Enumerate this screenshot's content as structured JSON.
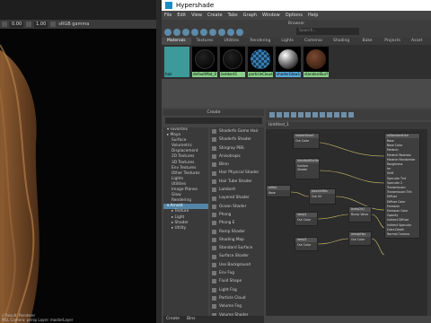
{
  "viewport": {
    "field1": "0.00",
    "field2": "1.00",
    "colorspace": "sRGB gamma",
    "status_line1": "// Result: Renderer",
    "status_line2": "MEL  Camera: persp  Layer: masterLayer"
  },
  "window": {
    "title": "Hypershade"
  },
  "menu": [
    "File",
    "Edit",
    "View",
    "Create",
    "Tabs",
    "Graph",
    "Window",
    "Options",
    "Help"
  ],
  "browser_label": "Browser",
  "search_placeholder": "Search...",
  "browser_tabs": [
    "Materials",
    "Textures",
    "Utilities",
    "Rendering",
    "Lights",
    "Cameras",
    "Shading Groups",
    "Bake Sets",
    "Projects",
    "Asset Nodes"
  ],
  "swatches": [
    {
      "label": "hair",
      "color": "#3c9a9a",
      "ball": "#2a8a8a",
      "type": "flat"
    },
    {
      "label": "defaultMat_0",
      "color": "#8ad08a",
      "ball": "#000",
      "type": "dark"
    },
    {
      "label": "lambert1",
      "color": "#8ad08a",
      "ball": "#000",
      "type": "dark"
    },
    {
      "label": "particleCloud1",
      "color": "#8ad08a",
      "ball": "#3a7fb0",
      "type": "checker"
    },
    {
      "label": "shaderGlow1",
      "color": "#58a8d8",
      "ball": "#ccc",
      "type": "sphere"
    },
    {
      "label": "standardSurf",
      "color": "#8ad08a",
      "ball": "#4a2a20",
      "type": "brown"
    }
  ],
  "create_panel": {
    "header": "Create"
  },
  "categories": [
    {
      "label": "▾ Favorites",
      "cls": ""
    },
    {
      "label": "▸ Maya",
      "cls": ""
    },
    {
      "label": "Surface",
      "cls": "sub"
    },
    {
      "label": "Volumetric",
      "cls": "sub"
    },
    {
      "label": "Displacement",
      "cls": "sub"
    },
    {
      "label": "2D Textures",
      "cls": "sub"
    },
    {
      "label": "3D Textures",
      "cls": "sub"
    },
    {
      "label": "Env Textures",
      "cls": "sub"
    },
    {
      "label": "Other Textures",
      "cls": "sub"
    },
    {
      "label": "Lights",
      "cls": "sub"
    },
    {
      "label": "Utilities",
      "cls": "sub"
    },
    {
      "label": "Image Planes",
      "cls": "sub"
    },
    {
      "label": "Glow",
      "cls": "sub"
    },
    {
      "label": "Rendering",
      "cls": "sub"
    },
    {
      "label": "▾ Arnold",
      "cls": "sel"
    },
    {
      "label": "▸ Texture",
      "cls": "sub"
    },
    {
      "label": "▸ Light",
      "cls": "sub"
    },
    {
      "label": "▸ Shader",
      "cls": "sub"
    },
    {
      "label": "▸ Utility",
      "cls": "sub"
    }
  ],
  "nodes": [
    "Shaderfx Game Hair",
    "Shaderfx Shader",
    "Stingray PBS",
    "Anisotropic",
    "Blinn",
    "Hair Physical Shader",
    "Hair Tube Shader",
    "Lambert",
    "Layered Shader",
    "Ocean Shader",
    "Phong",
    "Phong E",
    "Ramp Shader",
    "Shading Map",
    "Standard Surface",
    "Surface Shader",
    "Use Background",
    "Env Fog",
    "Fluid Shape",
    "Light Fog",
    "Particle Cloud",
    "Volume Fog",
    "Volume Shader"
  ],
  "bottom_tabs": [
    "Create",
    "Bins"
  ],
  "graph": {
    "tab": "Untitled_1",
    "nodes": [
      {
        "title": "shaderGlow1",
        "rows": [
          "Out Color",
          "Out Glow"
        ]
      },
      {
        "title": "standardSurface",
        "rows": [
          "Surface Shader",
          "Volume Shader",
          "Displacement"
        ]
      },
      {
        "title": "aiHair",
        "rows": [
          "Base",
          "Base Color",
          "Out Color"
        ]
      },
      {
        "title": "place2dTex",
        "rows": [
          "Out UV",
          "Out Color"
        ]
      },
      {
        "title": "ramp1",
        "rows": [
          "Out Color"
        ]
      },
      {
        "title": "bump2d1",
        "rows": [
          "Bump Value",
          "Out Normal"
        ]
      },
      {
        "title": "ramp2",
        "rows": [
          "Out Color"
        ]
      },
      {
        "title": "remapHsv",
        "rows": [
          "Out Color"
        ]
      },
      {
        "title": "aiStandardHair",
        "rows": [
          "Base",
          "Base Color",
          "Melanin",
          "Melanin Redness",
          "Melanin Randomize",
          "Roughness",
          "Ior",
          "Shift",
          "Specular Tint",
          "Specular 2",
          "Transmission",
          "Transmission Tint",
          "Diffuse",
          "Diffuse Color",
          "Emission",
          "Emission Color",
          "Opacity",
          "Indirect Diffuse",
          "Indirect Specular",
          "Extra Depth",
          "Normal Camera"
        ]
      }
    ]
  }
}
